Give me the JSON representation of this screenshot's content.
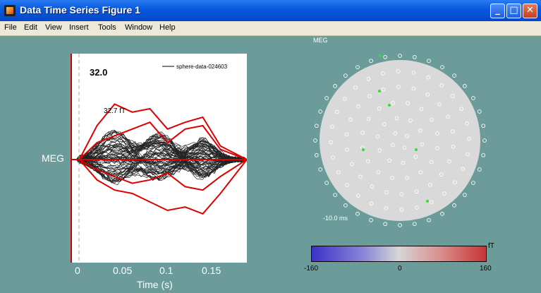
{
  "window": {
    "title": "Data Time Series Figure 1",
    "minimize_symbol": "_",
    "maximize_symbol": "□",
    "close_symbol": "✕"
  },
  "menu": [
    "File",
    "Edit",
    "View",
    "Insert",
    "Tools",
    "Window",
    "Help"
  ],
  "timeseries": {
    "current_value": "32.0",
    "peak_label": "32.7 fT",
    "legend_label": "sphere-data-024603",
    "channel_type_label": "MEG",
    "xlabel": "Time (s)",
    "xticks": [
      "0",
      "0.05",
      "0.1",
      "0.15"
    ],
    "colors": {
      "traces": "#222222",
      "highlight": "#dd0000",
      "cursor": "#cc0000"
    }
  },
  "chart_data": {
    "type": "line",
    "title": "",
    "xlabel": "Time (s)",
    "xlim": [
      -0.01,
      0.19
    ],
    "xticks": [
      0,
      0.05,
      0.1,
      0.15
    ],
    "series": [
      {
        "x": [
          0,
          0.02,
          0.04,
          0.06,
          0.08,
          0.1,
          0.12,
          0.14,
          0.16,
          0.19
        ],
        "values": [
          0,
          20,
          32.7,
          28,
          30,
          18,
          22,
          25,
          8,
          0
        ]
      },
      {
        "x": [
          0,
          0.02,
          0.04,
          0.06,
          0.08,
          0.1,
          0.12,
          0.14,
          0.16,
          0.19
        ],
        "values": [
          0,
          -12,
          -18,
          -20,
          -25,
          -30,
          -28,
          -32,
          -20,
          0
        ]
      },
      {
        "x": [
          0,
          0.02,
          0.04,
          0.06,
          0.08,
          0.1,
          0.12,
          0.14,
          0.16,
          0.19
        ],
        "values": [
          0,
          10,
          14,
          18,
          22,
          10,
          18,
          20,
          6,
          0
        ]
      },
      {
        "x": [
          0,
          0.02,
          0.04,
          0.06,
          0.08,
          0.1,
          0.12,
          0.14,
          0.16,
          0.19
        ],
        "values": [
          0,
          -6,
          -10,
          -14,
          -12,
          -8,
          -16,
          -18,
          -10,
          0
        ]
      }
    ]
  },
  "topography": {
    "title": "MEG",
    "time_label": "-10.0 ms",
    "colorbar": {
      "unit": "fT",
      "min_label": "-160",
      "mid_label": "0",
      "max_label": "160"
    }
  }
}
